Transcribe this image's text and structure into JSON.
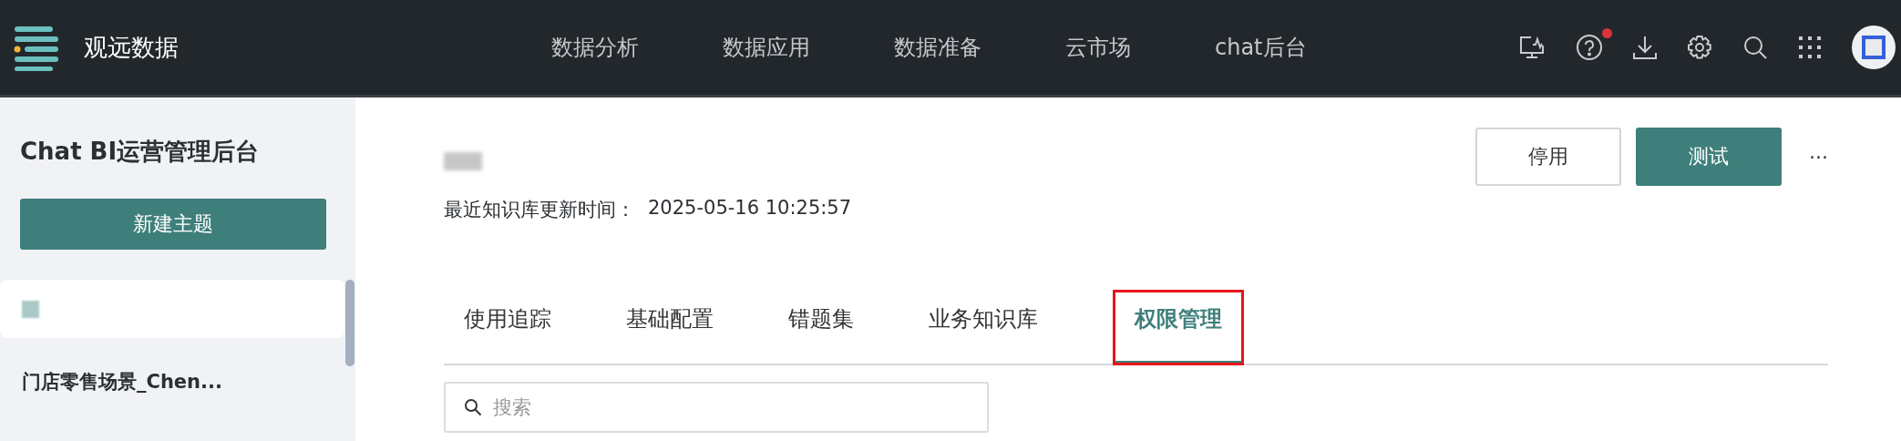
{
  "header": {
    "brand": "观远数据",
    "nav": [
      {
        "label": "数据分析",
        "selected": false
      },
      {
        "label": "数据应用",
        "selected": false
      },
      {
        "label": "数据准备",
        "selected": false
      },
      {
        "label": "云市场",
        "selected": false
      },
      {
        "label": "chat后台",
        "selected": false
      }
    ],
    "help_badge": true
  },
  "sidebar": {
    "title": "Chat BI运营管理后台",
    "new_button": "新建主题",
    "items": [
      {
        "redacted": true,
        "selected": true
      },
      {
        "label": "门店零售场景_Chen...",
        "redacted": false,
        "selected": false
      }
    ]
  },
  "main": {
    "title_redacted": true,
    "update_label": "最近知识库更新时间：",
    "update_time": "2025-05-16 10:25:57",
    "buttons": [
      {
        "label": "停用",
        "kind": "outline"
      },
      {
        "label": "测试",
        "kind": "primary"
      }
    ],
    "more": "···",
    "tabs": [
      {
        "label": "使用追踪",
        "selected": false,
        "outlined": false
      },
      {
        "label": "基础配置",
        "selected": false,
        "outlined": false
      },
      {
        "label": "错题集",
        "selected": false,
        "outlined": false
      },
      {
        "label": "业务知识库",
        "selected": false,
        "outlined": false
      },
      {
        "label": "权限管理",
        "selected": true,
        "outlined": true
      }
    ],
    "search": {
      "placeholder": "搜索"
    }
  }
}
